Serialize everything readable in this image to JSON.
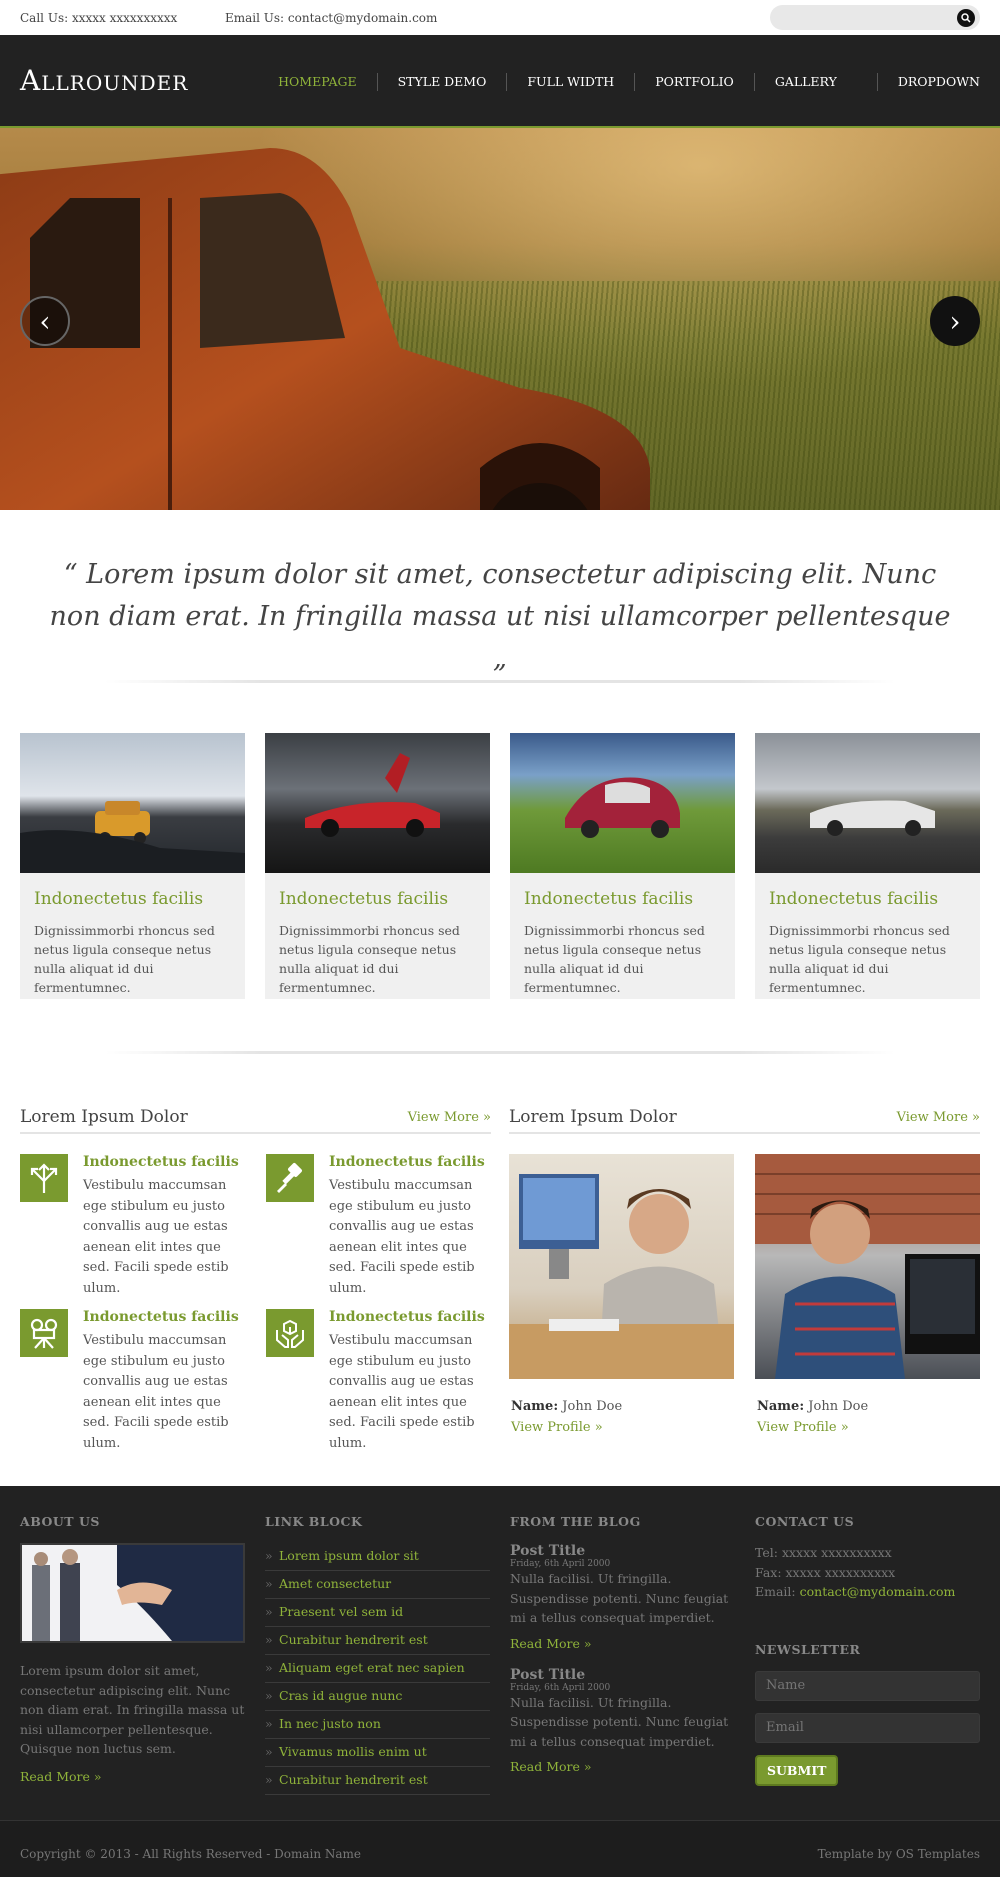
{
  "topbar": {
    "call": "Call Us: xxxxx xxxxxxxxxx",
    "email": "Email Us: contact@mydomain.com",
    "search_placeholder": ""
  },
  "header": {
    "logo": "Allrounder",
    "nav": [
      "HOMEPAGE",
      "STYLE DEMO",
      "FULL WIDTH",
      "PORTFOLIO",
      "GALLERY",
      "DROPDOWN"
    ]
  },
  "slider": {
    "prev": "‹",
    "next": "›"
  },
  "quote": "“ Lorem ipsum dolor sit amet, consectetur adipiscing elit. Nunc non diam erat. In fringilla massa ut nisi ullamcorper pellentesque „",
  "cards": [
    {
      "title": "Indonectetus facilis",
      "text": "Dignissimmorbi rhoncus sed netus ligula conseque netus nulla aliquat id dui fermentumnec."
    },
    {
      "title": "Indonectetus facilis",
      "text": "Dignissimmorbi rhoncus sed netus ligula conseque netus nulla aliquat id dui fermentumnec."
    },
    {
      "title": "Indonectetus facilis",
      "text": "Dignissimmorbi rhoncus sed netus ligula conseque netus nulla aliquat id dui fermentumnec."
    },
    {
      "title": "Indonectetus facilis",
      "text": "Dignissimmorbi rhoncus sed netus ligula conseque netus nulla aliquat id dui fermentumnec."
    }
  ],
  "services": {
    "title": "Lorem Ipsum Dolor",
    "view_more": "View More »",
    "items": [
      {
        "icon": "arrows-icon",
        "title": "Indonectetus facilis",
        "text": "Vestibulu maccumsan ege stibulum eu justo convallis aug ue estas aenean elit intes que sed. Facili spede estib ulum."
      },
      {
        "icon": "brush-icon",
        "title": "Indonectetus facilis",
        "text": "Vestibulu maccumsan ege stibulum eu justo convallis aug ue estas aenean elit intes que sed. Facili spede estib ulum."
      },
      {
        "icon": "camera-icon",
        "title": "Indonectetus facilis",
        "text": "Vestibulu maccumsan ege stibulum eu justo convallis aug ue estas aenean elit intes que sed. Facili spede estib ulum."
      },
      {
        "icon": "box-hands-icon",
        "title": "Indonectetus facilis",
        "text": "Vestibulu maccumsan ege stibulum eu justo convallis aug ue estas aenean elit intes que sed. Facili spede estib ulum."
      }
    ]
  },
  "team": {
    "title": "Lorem Ipsum Dolor",
    "view_more": "View More »",
    "members": [
      {
        "name_label": "Name:",
        "name": "John Doe",
        "link": "View Profile »"
      },
      {
        "name_label": "Name:",
        "name": "John Doe",
        "link": "View Profile »"
      }
    ]
  },
  "footer": {
    "about": {
      "heading": "ABOUT US",
      "text": "Lorem ipsum dolor sit amet, consectetur adipiscing elit. Nunc non diam erat. In fringilla massa ut nisi ullamcorper pellentesque. Quisque non luctus sem.",
      "read_more": "Read More »"
    },
    "links": {
      "heading": "LINK BLOCK",
      "items": [
        "Lorem ipsum dolor sit",
        "Amet consectetur",
        "Praesent vel sem id",
        "Curabitur hendrerit est",
        "Aliquam eget erat nec sapien",
        "Cras id augue nunc",
        "In nec justo non",
        "Vivamus mollis enim ut",
        "Curabitur hendrerit est"
      ]
    },
    "blog": {
      "heading": "FROM THE BLOG",
      "posts": [
        {
          "title": "Post Title",
          "date": "Friday, 6th April 2000",
          "text": "Nulla facilisi. Ut fringilla. Suspendisse potenti. Nunc feugiat mi a tellus consequat imperdiet.",
          "read_more": "Read More »"
        },
        {
          "title": "Post Title",
          "date": "Friday, 6th April 2000",
          "text": "Nulla facilisi. Ut fringilla. Suspendisse potenti. Nunc feugiat mi a tellus consequat imperdiet.",
          "read_more": "Read More »"
        }
      ]
    },
    "contact": {
      "heading": "CONTACT US",
      "tel": "Tel: xxxxx xxxxxxxxxx",
      "fax": "Fax: xxxxx xxxxxxxxxx",
      "email_label": "Email:",
      "email": "contact@mydomain.com"
    },
    "newsletter": {
      "heading": "NEWSLETTER",
      "name_placeholder": "Name",
      "email_placeholder": "Email",
      "submit": "SUBMIT"
    }
  },
  "bottom": {
    "copyright": "Copyright © 2013 - All Rights Reserved - Domain Name",
    "credit": "Template by OS Templates"
  },
  "colors": {
    "accent": "#7a9a2f",
    "dark": "#222222"
  }
}
